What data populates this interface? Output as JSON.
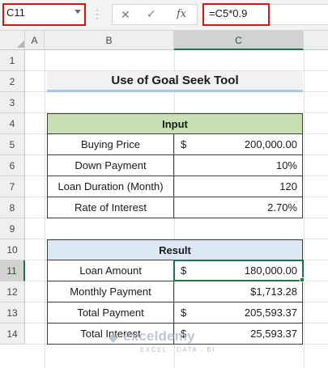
{
  "formula_bar": {
    "name_box": "C11",
    "cancel_glyph": "✕",
    "confirm_glyph": "✓",
    "fx_label": "fx",
    "formula": "=C5*0.9"
  },
  "columns": [
    "A",
    "B",
    "C"
  ],
  "selected_column": "C",
  "rows": [
    "1",
    "2",
    "3",
    "4",
    "5",
    "6",
    "7",
    "8",
    "9",
    "10",
    "11",
    "12",
    "13",
    "14"
  ],
  "selected_row": "11",
  "title": "Use of Goal Seek Tool",
  "input_table": {
    "header": "Input",
    "rows": [
      {
        "label": "Buying Price",
        "currency": "$",
        "value": "200,000.00"
      },
      {
        "label": "Down Payment",
        "currency": "",
        "value": "10%"
      },
      {
        "label": "Loan Duration (Month)",
        "currency": "",
        "value": "120"
      },
      {
        "label": "Rate of Interest",
        "currency": "",
        "value": "2.70%"
      }
    ]
  },
  "result_table": {
    "header": "Result",
    "rows": [
      {
        "label": "Loan Amount",
        "currency": "$",
        "value": "180,000.00"
      },
      {
        "label": "Monthly Payment",
        "currency": "",
        "value": "$1,713.28"
      },
      {
        "label": "Total Payment",
        "currency": "$",
        "value": "205,593.37"
      },
      {
        "label": "Total Interest",
        "currency": "$",
        "value": "25,593.37"
      }
    ]
  },
  "watermark": {
    "name": "exceldemy",
    "tagline": "EXCEL · DATA · BI"
  },
  "colors": {
    "accent": "#217346",
    "highlight": "#e01010",
    "input_header_bg": "#c6e0b4",
    "result_header_bg": "#dbe7f4",
    "title_underline": "#a9c4e4"
  }
}
